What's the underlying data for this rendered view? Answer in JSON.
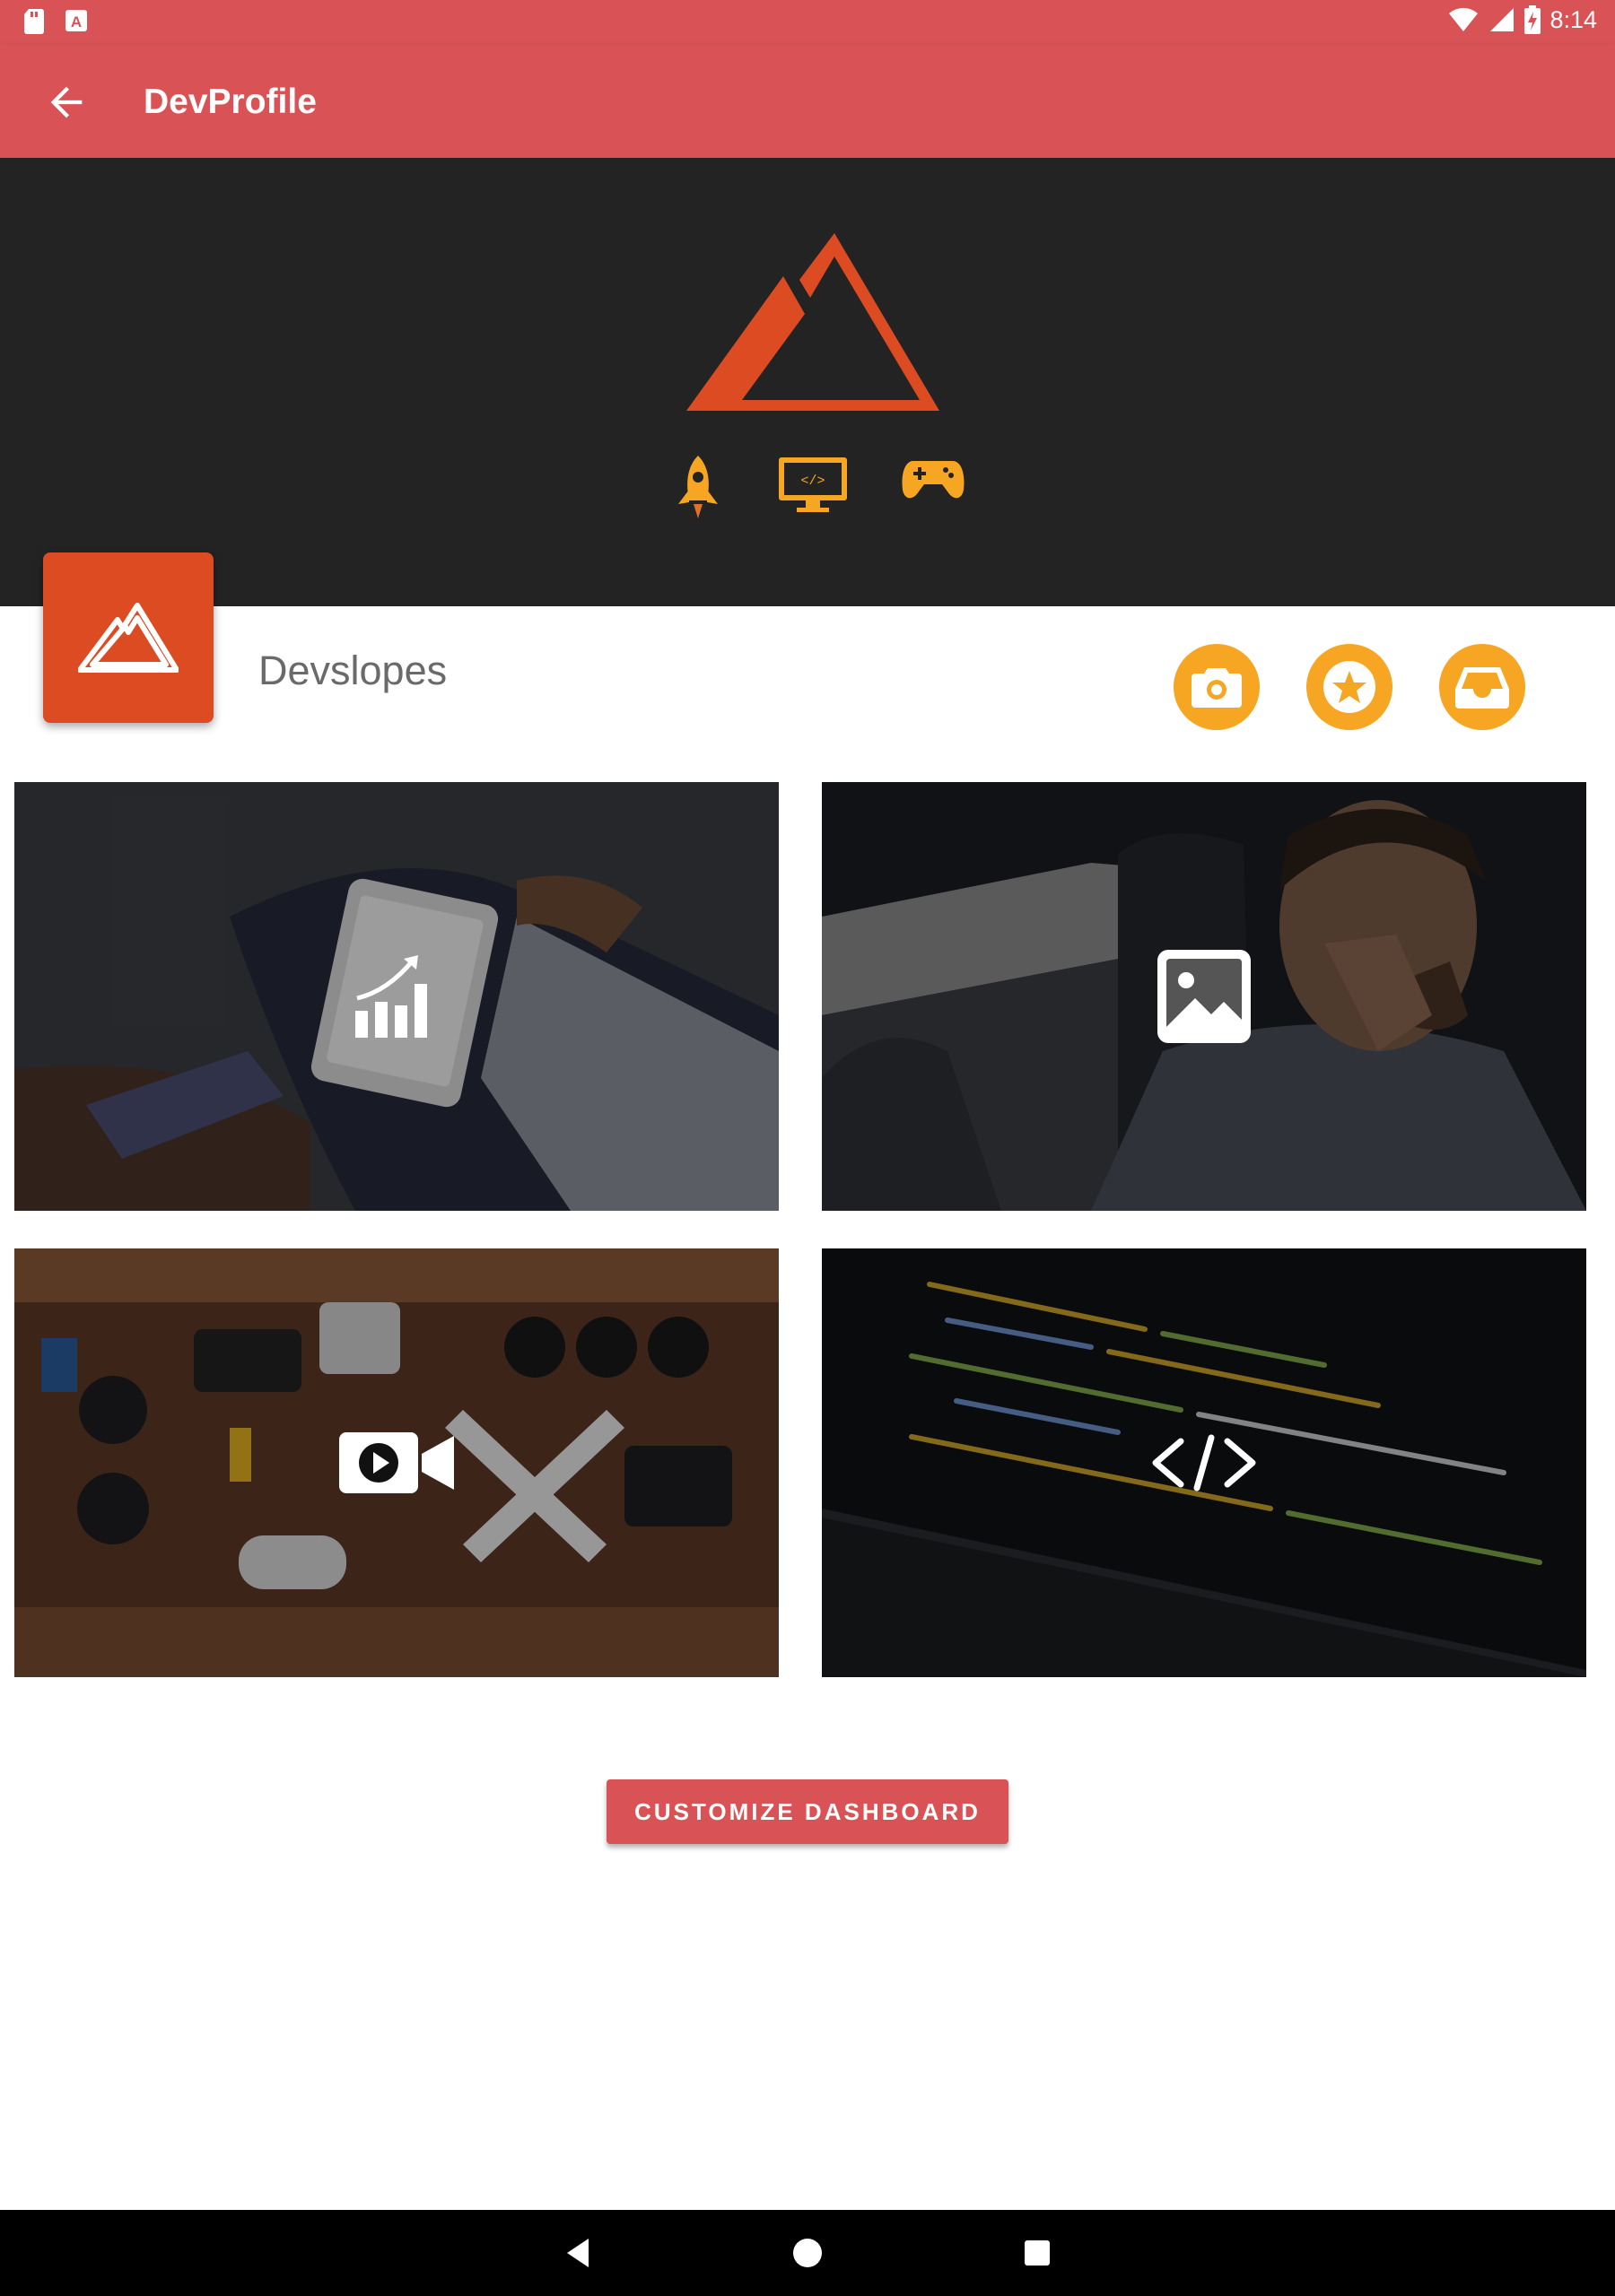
{
  "status_bar": {
    "time": "8:14",
    "left_icons": [
      "sd-card-icon",
      "keyboard-a-icon"
    ],
    "right_icons": [
      "wifi-icon",
      "signal-icon",
      "battery-charging-icon"
    ]
  },
  "app_bar": {
    "title": "DevProfile",
    "back_icon": "arrow-back-icon",
    "color": "#d95356"
  },
  "hero": {
    "background": "#232323",
    "logo_color": "#dc4b22",
    "mini_icons": [
      "rocket-icon",
      "monitor-code-icon",
      "gamepad-icon"
    ],
    "mini_icon_color": "#f6a623"
  },
  "profile": {
    "name": "Devslopes",
    "logo_color": "#dc4b22",
    "actions": [
      {
        "name": "camera-button",
        "icon": "camera-icon"
      },
      {
        "name": "star-button",
        "icon": "star-icon"
      },
      {
        "name": "inbox-button",
        "icon": "inbox-icon"
      }
    ],
    "action_color": "#f6a623"
  },
  "tiles": [
    {
      "name": "analytics-tile",
      "icon": "bar-chart-icon",
      "photo": "tablet-analytics"
    },
    {
      "name": "images-tile",
      "icon": "image-icon",
      "photo": "man-thinking"
    },
    {
      "name": "video-tile",
      "icon": "video-camera-icon",
      "photo": "camera-gear-flatlay"
    },
    {
      "name": "code-tile",
      "icon": "code-brackets-icon",
      "photo": "laptop-code"
    }
  ],
  "cta": {
    "label": "CUSTOMIZE DASHBOARD"
  },
  "nav_bar": {
    "buttons": [
      "back-triangle-icon",
      "home-circle-icon",
      "recents-square-icon"
    ]
  }
}
